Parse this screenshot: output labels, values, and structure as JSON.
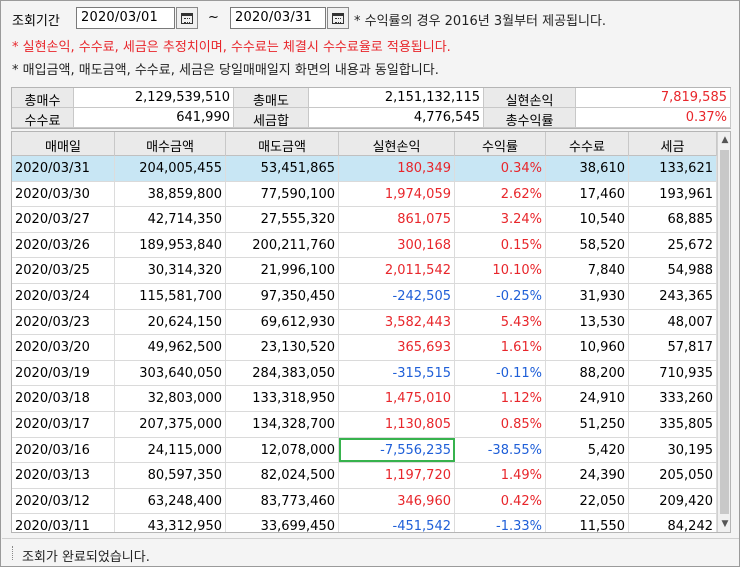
{
  "query": {
    "period_label": "조회기간",
    "start_date": "2020/03/01",
    "tilde": "~",
    "end_date": "2020/03/31",
    "notice": "* 수익률의 경우 2016년 3월부터 제공됩니다."
  },
  "notes": {
    "line1": "* 실현손익, 수수료, 세금은 추정치이며, 수수료는 체결시 수수료율로 적용됩니다.",
    "line2": "* 매입금액, 매도금액, 수수료, 세금은 당일매매일지 화면의 내용과 동일합니다."
  },
  "summary": {
    "total_buy_label": "총매수",
    "total_buy": "2,129,539,510",
    "total_sell_label": "총매도",
    "total_sell": "2,151,132,115",
    "realized_label": "실현손익",
    "realized": "7,819,585",
    "fee_label": "수수료",
    "fee": "641,990",
    "tax_label": "세금합",
    "tax": "4,776,545",
    "return_label": "총수익률",
    "return": "0.37%"
  },
  "grid": {
    "headers": [
      "매매일",
      "매수금액",
      "매도금액",
      "실현손익",
      "수익률",
      "수수료",
      "세금"
    ],
    "rows": [
      [
        "2020/03/31",
        "204,005,455",
        "53,451,865",
        "180,349",
        "0.34%",
        "38,610",
        "133,621"
      ],
      [
        "2020/03/30",
        "38,859,800",
        "77,590,100",
        "1,974,059",
        "2.62%",
        "17,460",
        "193,961"
      ],
      [
        "2020/03/27",
        "42,714,350",
        "27,555,320",
        "861,075",
        "3.24%",
        "10,540",
        "68,885"
      ],
      [
        "2020/03/26",
        "189,953,840",
        "200,211,760",
        "300,168",
        "0.15%",
        "58,520",
        "25,672"
      ],
      [
        "2020/03/25",
        "30,314,320",
        "21,996,100",
        "2,011,542",
        "10.10%",
        "7,840",
        "54,988"
      ],
      [
        "2020/03/24",
        "115,581,700",
        "97,350,450",
        "-242,505",
        "-0.25%",
        "31,930",
        "243,365"
      ],
      [
        "2020/03/23",
        "20,624,150",
        "69,612,930",
        "3,582,443",
        "5.43%",
        "13,530",
        "48,007"
      ],
      [
        "2020/03/20",
        "49,962,500",
        "23,130,520",
        "365,693",
        "1.61%",
        "10,960",
        "57,817"
      ],
      [
        "2020/03/19",
        "303,640,050",
        "284,383,050",
        "-315,515",
        "-0.11%",
        "88,200",
        "710,935"
      ],
      [
        "2020/03/18",
        "32,803,000",
        "133,318,950",
        "1,475,010",
        "1.12%",
        "24,910",
        "333,260"
      ],
      [
        "2020/03/17",
        "207,375,000",
        "134,328,700",
        "1,130,805",
        "0.85%",
        "51,250",
        "335,805"
      ],
      [
        "2020/03/16",
        "24,115,000",
        "12,078,000",
        "-7,556,235",
        "-38.55%",
        "5,420",
        "30,195"
      ],
      [
        "2020/03/13",
        "80,597,350",
        "82,024,500",
        "1,197,720",
        "1.49%",
        "24,390",
        "205,050"
      ],
      [
        "2020/03/12",
        "63,248,400",
        "83,773,460",
        "346,960",
        "0.42%",
        "22,050",
        "209,420"
      ],
      [
        "2020/03/11",
        "43,312,950",
        "33,699,450",
        "-451,542",
        "-1.33%",
        "11,550",
        "84,242"
      ]
    ]
  },
  "status": {
    "message": "조회가 완료되었습니다."
  },
  "colors": {
    "positive": "#e8262b",
    "negative": "#1f5fd8",
    "selected_row": "#c8e6f4",
    "focus_outline": "#37b24d"
  }
}
